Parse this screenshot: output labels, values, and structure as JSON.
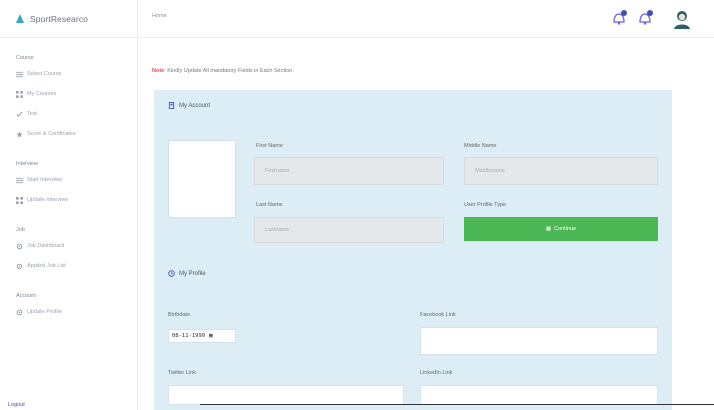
{
  "brand": {
    "name": "SportResearco"
  },
  "topbar": {
    "breadcrumb": "Home"
  },
  "sidebar": {
    "groups": [
      {
        "title": "Course",
        "items": [
          {
            "label": "Select Course",
            "icon": "list-icon"
          },
          {
            "label": "My Courses",
            "icon": "grid-icon"
          },
          {
            "label": "Test",
            "icon": "check-icon"
          },
          {
            "label": "Score & Certificates",
            "icon": "star-icon"
          }
        ]
      },
      {
        "title": "Interview",
        "items": [
          {
            "label": "Start Interview",
            "icon": "list-icon"
          },
          {
            "label": "Update Interview",
            "icon": "grid-icon"
          }
        ]
      },
      {
        "title": "Job",
        "items": [
          {
            "label": "Job Dashboard",
            "icon": "gear-icon"
          },
          {
            "label": "Applied Job List",
            "icon": "gear-icon"
          }
        ]
      },
      {
        "title": "Account",
        "items": [
          {
            "label": "Update Profile",
            "icon": "gear-icon"
          }
        ]
      }
    ],
    "bottom_label": "Logout"
  },
  "note": {
    "prefix": "Note",
    "text": ": Kindly Update All mandatory Fields in Each Section."
  },
  "account": {
    "heading": "My Account",
    "first_name_label": "First Name",
    "first_name_placeholder": "Firstname",
    "middle_name_label": "Middle Name",
    "middle_name_placeholder": "Middlename",
    "last_name_label": "Last Name",
    "last_name_placeholder": "Lastname",
    "user_type_label": "User Profile Type",
    "continue_label": "Continue"
  },
  "profile": {
    "heading": "My Profile",
    "birthday_label": "Birthdate",
    "birthday_value": "08-11-1999",
    "facebook_label": "Facebook Link",
    "twitter_label": "Twitter Link",
    "linkedin_label": "LinkedIn Link"
  },
  "colors": {
    "accent": "#4cb755",
    "panel": "#dcedf6",
    "note": "#d9534f",
    "badge": "#3f51b5"
  }
}
